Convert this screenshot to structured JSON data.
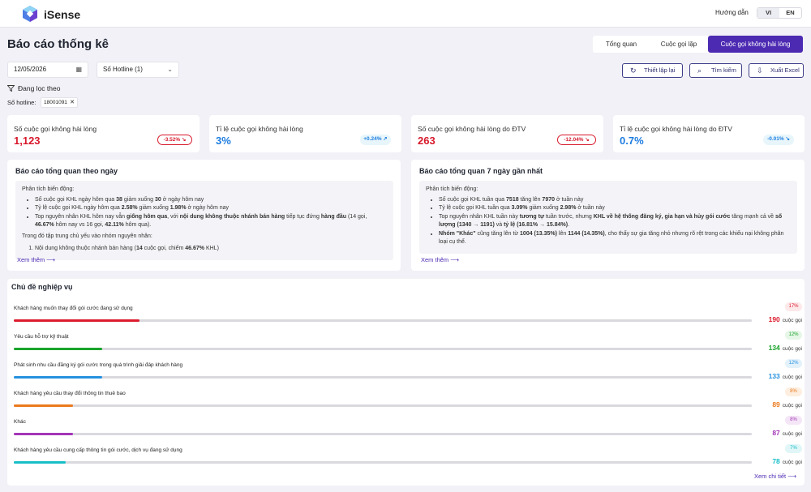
{
  "header": {
    "brand": "iSense",
    "guide": "Hướng dẫn",
    "lang": [
      "VI",
      "EN"
    ]
  },
  "page": {
    "title": "Báo cáo thống kê"
  },
  "tabs": [
    "Tổng quan",
    "Cuộc gọi lặp",
    "Cuộc gọi không hài lòng"
  ],
  "filters": {
    "date": "12/05/2026",
    "hotline": "Số Hotline (1)"
  },
  "actions": {
    "reset": "Thiết lập lại",
    "search": "Tìm kiếm",
    "export": "Xuất Excel"
  },
  "active_filter": {
    "label": "Đang lọc theo",
    "key": "Số hotline:",
    "value": "18001091"
  },
  "kpis": [
    {
      "label": "Số cuộc gọi không hài lòng",
      "value": "1,123",
      "change": "-3.52%",
      "arrow": "↘"
    },
    {
      "label": "Tỉ lệ cuộc gọi không hài lòng",
      "value": "3%",
      "change": "+0.24%",
      "arrow": "↗"
    },
    {
      "label": "Số cuộc gọi không hài lòng do ĐTV",
      "value": "263",
      "change": "-12.04%",
      "arrow": "↘"
    },
    {
      "label": "Tỉ lệ cuộc gọi không hài lòng do ĐTV",
      "value": "0.7%",
      "change": "-0.01%",
      "arrow": "↘"
    }
  ],
  "report_day": {
    "title": "Báo cáo tổng quan theo ngày",
    "intro": "Phân tích biến động:",
    "b1": [
      "Số cuộc gọi KHL ngày hôm qua ",
      "38",
      " giảm xuống ",
      "30",
      " ở ngày hôm nay"
    ],
    "b2": [
      "Tỷ lệ cuộc gọi KHL ngày hôm qua ",
      "2.58%",
      " giảm xuống ",
      "1.98%",
      " ở ngày hôm nay"
    ],
    "b3": [
      "Top nguyên nhân KHL hôm nay vẫn ",
      "giống hôm qua",
      ", với ",
      "nội dung không thuộc nhánh bán hàng",
      " tiếp tục đứng ",
      "hàng đầu",
      " (14 gọi, ",
      "46.67%",
      " hôm nay vs 16 gọi, ",
      "42.11%",
      " hôm qua)."
    ],
    "p2": "Trong đó tập trung chủ yếu vào nhóm nguyên nhân:",
    "o1": [
      "Nội dung không thuộc nhánh bán hàng (",
      "14",
      " cuộc gọi, chiếm ",
      "46.67%",
      " KHL)"
    ],
    "more": "Xem thêm"
  },
  "report_week": {
    "title": "Báo cáo tổng quan 7 ngày gần nhất",
    "intro": "Phân tích biến động:",
    "b1": [
      "Số cuộc gọi KHL tuần qua ",
      "7518",
      " tăng lên ",
      "7970",
      " ở tuần này"
    ],
    "b2": [
      "Tỷ lệ cuộc gọi KHL tuần qua ",
      "3.09%",
      " giảm xuống ",
      "2.98%",
      " ở tuần này"
    ],
    "b3": [
      "Top nguyên nhân KHL tuần này ",
      "tương tự",
      " tuần trước, nhưng ",
      "KHL về hệ thống đăng ký, gia hạn và hủy gói cước",
      " tăng mạnh cả về ",
      "số lượng (1340 → 1191)",
      " và ",
      "tỷ lệ",
      " ",
      "(16.81% → 15.84%)",
      "."
    ],
    "b4": [
      "Nhóm \"Khác\"",
      " cũng tăng lên từ ",
      "1004 (13.35%)",
      " lên ",
      "1144 (14.35%)",
      ", cho thấy sự gia tăng nhỏ nhưng rõ rệt trong các khiếu nại không phân loại cụ thể."
    ],
    "more": "Xem thêm"
  },
  "topics": {
    "title": "Chủ đề nghiệp vụ",
    "unit": "cuộc gọi",
    "see_all": "Xem chi tiết",
    "items": [
      {
        "name": "Khách hàng muốn thay đổi gói cước đang sử dụng",
        "pct": "17%",
        "count": "190",
        "ratio": 0.17,
        "color": "#dc1c2e",
        "tint": "#fde8ea"
      },
      {
        "name": "Yêu cầu hỗ trợ kỹ thuật",
        "pct": "12%",
        "count": "134",
        "ratio": 0.12,
        "color": "#1aa32a",
        "tint": "#e6f6e7"
      },
      {
        "name": "Phát sinh nhu cầu đăng ký gói cước trong quá trình giải đáp khách hàng",
        "pct": "12%",
        "count": "133",
        "ratio": 0.12,
        "color": "#2591df",
        "tint": "#e3f1fb"
      },
      {
        "name": "Khách hàng yêu cầu thay đổi thông tin thuê bao",
        "pct": "8%",
        "count": "89",
        "ratio": 0.08,
        "color": "#ea7a1e",
        "tint": "#fdeedf"
      },
      {
        "name": "Khác",
        "pct": "8%",
        "count": "87",
        "ratio": 0.08,
        "color": "#a334b7",
        "tint": "#f4e6f7"
      },
      {
        "name": "Khách hàng yêu cầu cung cấp thông tin gói cước, dịch vụ đang sử dụng",
        "pct": "7%",
        "count": "78",
        "ratio": 0.07,
        "color": "#17bec8",
        "tint": "#e0f6f7"
      }
    ]
  },
  "colors": {
    "accent": "#4c2ab2",
    "negative": "#d7192b",
    "positive": "#1d7de0"
  }
}
